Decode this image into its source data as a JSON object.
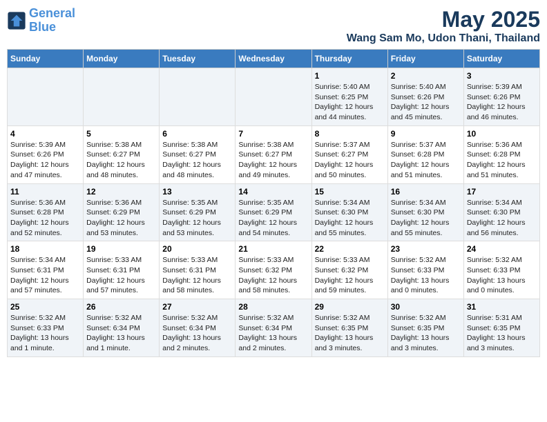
{
  "logo": {
    "line1": "General",
    "line2": "Blue"
  },
  "title": "May 2025",
  "subtitle": "Wang Sam Mo, Udon Thani, Thailand",
  "days_of_week": [
    "Sunday",
    "Monday",
    "Tuesday",
    "Wednesday",
    "Thursday",
    "Friday",
    "Saturday"
  ],
  "weeks": [
    [
      {
        "day": "",
        "content": ""
      },
      {
        "day": "",
        "content": ""
      },
      {
        "day": "",
        "content": ""
      },
      {
        "day": "",
        "content": ""
      },
      {
        "day": "1",
        "content": "Sunrise: 5:40 AM\nSunset: 6:25 PM\nDaylight: 12 hours\nand 44 minutes."
      },
      {
        "day": "2",
        "content": "Sunrise: 5:40 AM\nSunset: 6:26 PM\nDaylight: 12 hours\nand 45 minutes."
      },
      {
        "day": "3",
        "content": "Sunrise: 5:39 AM\nSunset: 6:26 PM\nDaylight: 12 hours\nand 46 minutes."
      }
    ],
    [
      {
        "day": "4",
        "content": "Sunrise: 5:39 AM\nSunset: 6:26 PM\nDaylight: 12 hours\nand 47 minutes."
      },
      {
        "day": "5",
        "content": "Sunrise: 5:38 AM\nSunset: 6:27 PM\nDaylight: 12 hours\nand 48 minutes."
      },
      {
        "day": "6",
        "content": "Sunrise: 5:38 AM\nSunset: 6:27 PM\nDaylight: 12 hours\nand 48 minutes."
      },
      {
        "day": "7",
        "content": "Sunrise: 5:38 AM\nSunset: 6:27 PM\nDaylight: 12 hours\nand 49 minutes."
      },
      {
        "day": "8",
        "content": "Sunrise: 5:37 AM\nSunset: 6:27 PM\nDaylight: 12 hours\nand 50 minutes."
      },
      {
        "day": "9",
        "content": "Sunrise: 5:37 AM\nSunset: 6:28 PM\nDaylight: 12 hours\nand 51 minutes."
      },
      {
        "day": "10",
        "content": "Sunrise: 5:36 AM\nSunset: 6:28 PM\nDaylight: 12 hours\nand 51 minutes."
      }
    ],
    [
      {
        "day": "11",
        "content": "Sunrise: 5:36 AM\nSunset: 6:28 PM\nDaylight: 12 hours\nand 52 minutes."
      },
      {
        "day": "12",
        "content": "Sunrise: 5:36 AM\nSunset: 6:29 PM\nDaylight: 12 hours\nand 53 minutes."
      },
      {
        "day": "13",
        "content": "Sunrise: 5:35 AM\nSunset: 6:29 PM\nDaylight: 12 hours\nand 53 minutes."
      },
      {
        "day": "14",
        "content": "Sunrise: 5:35 AM\nSunset: 6:29 PM\nDaylight: 12 hours\nand 54 minutes."
      },
      {
        "day": "15",
        "content": "Sunrise: 5:34 AM\nSunset: 6:30 PM\nDaylight: 12 hours\nand 55 minutes."
      },
      {
        "day": "16",
        "content": "Sunrise: 5:34 AM\nSunset: 6:30 PM\nDaylight: 12 hours\nand 55 minutes."
      },
      {
        "day": "17",
        "content": "Sunrise: 5:34 AM\nSunset: 6:30 PM\nDaylight: 12 hours\nand 56 minutes."
      }
    ],
    [
      {
        "day": "18",
        "content": "Sunrise: 5:34 AM\nSunset: 6:31 PM\nDaylight: 12 hours\nand 57 minutes."
      },
      {
        "day": "19",
        "content": "Sunrise: 5:33 AM\nSunset: 6:31 PM\nDaylight: 12 hours\nand 57 minutes."
      },
      {
        "day": "20",
        "content": "Sunrise: 5:33 AM\nSunset: 6:31 PM\nDaylight: 12 hours\nand 58 minutes."
      },
      {
        "day": "21",
        "content": "Sunrise: 5:33 AM\nSunset: 6:32 PM\nDaylight: 12 hours\nand 58 minutes."
      },
      {
        "day": "22",
        "content": "Sunrise: 5:33 AM\nSunset: 6:32 PM\nDaylight: 12 hours\nand 59 minutes."
      },
      {
        "day": "23",
        "content": "Sunrise: 5:32 AM\nSunset: 6:33 PM\nDaylight: 13 hours\nand 0 minutes."
      },
      {
        "day": "24",
        "content": "Sunrise: 5:32 AM\nSunset: 6:33 PM\nDaylight: 13 hours\nand 0 minutes."
      }
    ],
    [
      {
        "day": "25",
        "content": "Sunrise: 5:32 AM\nSunset: 6:33 PM\nDaylight: 13 hours\nand 1 minute."
      },
      {
        "day": "26",
        "content": "Sunrise: 5:32 AM\nSunset: 6:34 PM\nDaylight: 13 hours\nand 1 minute."
      },
      {
        "day": "27",
        "content": "Sunrise: 5:32 AM\nSunset: 6:34 PM\nDaylight: 13 hours\nand 2 minutes."
      },
      {
        "day": "28",
        "content": "Sunrise: 5:32 AM\nSunset: 6:34 PM\nDaylight: 13 hours\nand 2 minutes."
      },
      {
        "day": "29",
        "content": "Sunrise: 5:32 AM\nSunset: 6:35 PM\nDaylight: 13 hours\nand 3 minutes."
      },
      {
        "day": "30",
        "content": "Sunrise: 5:32 AM\nSunset: 6:35 PM\nDaylight: 13 hours\nand 3 minutes."
      },
      {
        "day": "31",
        "content": "Sunrise: 5:31 AM\nSunset: 6:35 PM\nDaylight: 13 hours\nand 3 minutes."
      }
    ]
  ]
}
